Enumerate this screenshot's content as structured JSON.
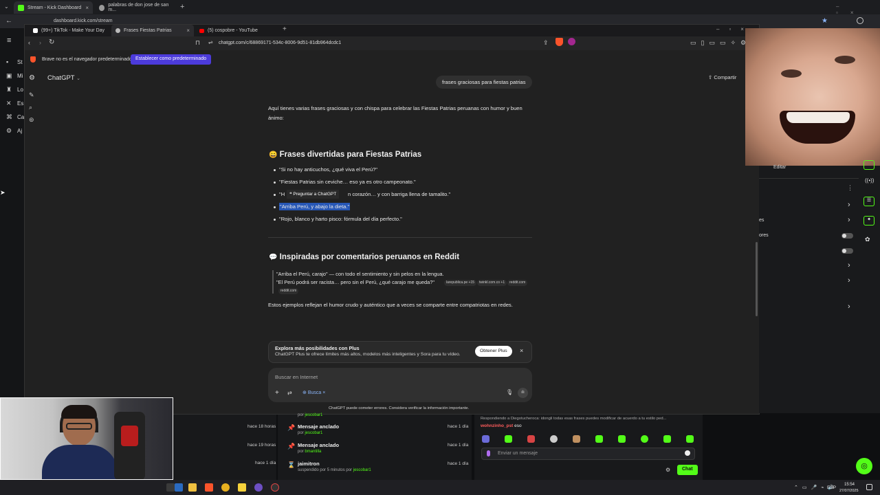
{
  "outer_browser": {
    "tabs": [
      {
        "title": "Stream - Kick Dashboard",
        "color": "#53fc18"
      },
      {
        "title": "palabras de don jose de san m...",
        "color": "#aaaaaa"
      }
    ],
    "url": "dashboard.kick.com/stream"
  },
  "inner_browser": {
    "tabs": [
      {
        "title": "(99+) TikTok - Make Your Day",
        "color": "#ffffff"
      },
      {
        "title": "Frases Fiestas Patrias",
        "color": "#bbbbbb"
      },
      {
        "title": "(5) cospobre - YouTube",
        "color": "#ff0000"
      }
    ],
    "url": "chatgpt.com/c/68869171-534c-8006-9d51-81db964dcdc1",
    "default_banner": {
      "text": "Brave no es el navegador predeterminado",
      "button": "Establecer como predeterminado"
    }
  },
  "kick_sidebar": {
    "items": [
      "St",
      "Mi",
      "Lo",
      "Es",
      "Ca",
      "Aj"
    ]
  },
  "chatgpt": {
    "model": "ChatGPT",
    "share": "Compartir",
    "user_message": "frases graciosas para fiestas patrias",
    "intro": "Aquí tienes varias frases graciosas y con chispa para celebrar las Fiestas Patrias peruanas con humor y buen ánimo:",
    "section1_title": "Frases divertidas para Fiestas Patrias",
    "section1_emoji": "😄",
    "phrases": [
      "\"Si no hay anticuchos, ¿qué viva el Perú?\"",
      "\"Fiestas Patrias sin ceviche… eso ya es otro campeonato.\"",
      "\"H",
      "\"Arriba Perú, y abajo la dieta.\"",
      "\"Rojo, blanco y harto pisco: fórmula del día perfecto.\""
    ],
    "phrase3_tail": "n corazón… y con barriga llena de tamalito.\"",
    "ask_tooltip": "Preguntar a ChatGPT",
    "section2_title": "Inspiradas por comentarios peruanos en Reddit",
    "section2_emoji": "💬",
    "quote1": "\"Arriba el Perú, carajo\" — con todo el sentimiento y sin pelos en la lengua.",
    "quote2": "\"El Perú podrá ser racista… pero sin el Perú, ¿qué carajo me queda?\"",
    "sources": [
      "larepublica.pe +15",
      "twinkl.com.co +1",
      "reddit.com",
      "reddit.com"
    ],
    "outro": "Estos ejemplos reflejan el humor crudo y auténtico que a veces se comparte entre compatriotas en redes.",
    "plus_title": "Explora más posibilidades con Plus",
    "plus_desc": "ChatGPT Plus te ofrece límites más altos, modelos más inteligentes y Sora para tu vídeo.",
    "plus_button": "Obtener Plus",
    "input_placeholder": "Buscar en Internet",
    "search_chip": "Busca",
    "disclaimer": "ChatGPT puede cometer errores. Considera verificar la información importante."
  },
  "kick_right": {
    "edit": "Editar",
    "labels": [
      "es",
      "ores"
    ]
  },
  "activity": {
    "rows": [
      {
        "title": "",
        "by": "por",
        "user": "jescobar1",
        "time": ""
      },
      {
        "title": "Mensaje anclado",
        "by": "por",
        "user": "jescobar1",
        "time": "hace 1 día"
      },
      {
        "title": "Mensaje anclado",
        "by": "por",
        "user": "bmantilla",
        "time": "hace 1 día"
      },
      {
        "title": "jaimitron",
        "by": "suspendido por 5 minutos por",
        "user": "jescobar1",
        "time": "hace 1 día"
      }
    ],
    "left_times": [
      "hace 18 horas",
      "hace 19 horas",
      "hace 1 día"
    ]
  },
  "kick_chat": {
    "reply_line": "Respondiendo a Diegotucheroca: idongli todas esas frases puedes modificar de acuerdo a tu estilo ped...",
    "user": "wohnzinho_pst",
    "msg": "eso",
    "input_placeholder": "Enviar un mensaje",
    "chat_button": "Chat"
  },
  "taskbar": {
    "lang": "ESP",
    "time": "15:54",
    "date": "27/07/2025"
  }
}
